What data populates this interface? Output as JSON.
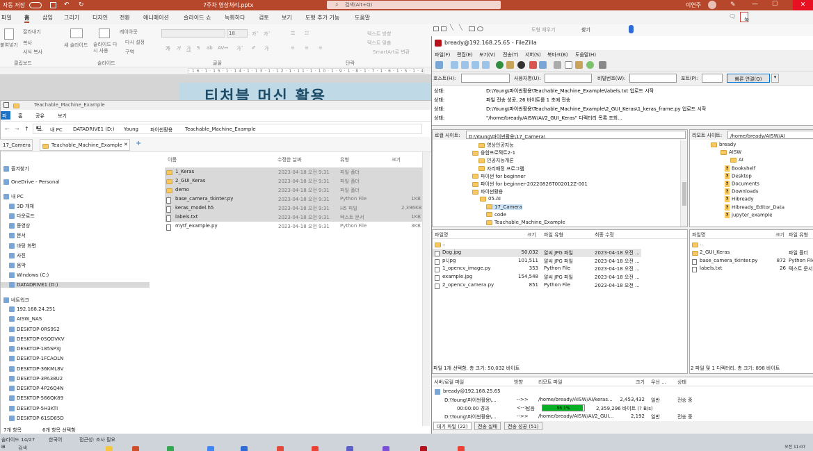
{
  "ppt": {
    "autosave": "자동 저장",
    "filename": "7주차 영상처리.pptx",
    "search": "검색(Alt+Q)",
    "user": "이연주",
    "record_button": "녹화하다",
    "tabs": [
      "파일",
      "홈",
      "삽입",
      "그리기",
      "디자인",
      "전환",
      "애니메이션",
      "슬라이드 쇼",
      "녹화하다",
      "검토",
      "보기",
      "도형 추가 기능",
      "도움말"
    ],
    "ribbon": {
      "paste": "붙여넣기",
      "cut": "잘라내기",
      "copy": "복사",
      "format_copy": "서식 복사",
      "clipboard": "클립보드",
      "new_slide": "새 슬라이드",
      "reuse_slide": "슬라이드 다시 사용",
      "layout": "레이아웃",
      "reset": "다시 설정",
      "section": "구역",
      "slides_group": "슬라이드",
      "font_size": "18",
      "font_group": "글꼴",
      "paragraph_group": "단락",
      "text_direction": "텍스트 방향",
      "text_align": "텍스트 맞춤",
      "smartart": "SmartArt로 변환",
      "shape_fill": "도형 채우기",
      "find": "찾기"
    },
    "slide_title": "티처블 머신 활용",
    "status_slide": "슬라이드 14/27",
    "status_lang": "한국어",
    "status_access": "접근성: 조사 필요"
  },
  "explorer": {
    "title": "Teachable_Machine_Example",
    "menu": [
      "파일",
      "홈",
      "공유",
      "보기"
    ],
    "address": [
      "내 PC",
      "DATADRIVE1 (D:)",
      "Young",
      "파이썬활용",
      "Teachable_Machine_Example"
    ],
    "tabs": [
      "17_Camera",
      "Teachable_Machine_Example"
    ],
    "nav": [
      {
        "label": "즐겨찾기",
        "icon": "star-icon"
      },
      {
        "label": "OneDrive - Personal",
        "icon": "cloud-icon"
      },
      {
        "label": "내 PC",
        "icon": "pc-icon"
      },
      {
        "label": "3D 개체",
        "icon": "cube-icon"
      },
      {
        "label": "다운로드",
        "icon": "download-icon"
      },
      {
        "label": "동영상",
        "icon": "video-icon"
      },
      {
        "label": "문서",
        "icon": "document-icon"
      },
      {
        "label": "바탕 화면",
        "icon": "desktop-icon"
      },
      {
        "label": "사진",
        "icon": "picture-icon"
      },
      {
        "label": "음악",
        "icon": "music-icon"
      },
      {
        "label": "Windows (C:)",
        "icon": "drive-icon"
      },
      {
        "label": "DATADRIVE1 (D:)",
        "icon": "drive-icon"
      },
      {
        "label": "네트워크",
        "icon": "network-icon"
      },
      {
        "label": "192.168.24.251",
        "icon": "computer-icon"
      },
      {
        "label": "AISW_NAS",
        "icon": "computer-icon"
      },
      {
        "label": "DESKTOP-0RS9S2",
        "icon": "computer-icon"
      },
      {
        "label": "DESKTOP-0SQDVKV",
        "icon": "computer-icon"
      },
      {
        "label": "DESKTOP-185SP3J",
        "icon": "computer-icon"
      },
      {
        "label": "DESKTOP-1FCAOLN",
        "icon": "computer-icon"
      },
      {
        "label": "DESKTOP-36KML8V",
        "icon": "computer-icon"
      },
      {
        "label": "DESKTOP-3PA38U2",
        "icon": "computer-icon"
      },
      {
        "label": "DESKTOP-4P26Q4N",
        "icon": "computer-icon"
      },
      {
        "label": "DESKTOP-566QK89",
        "icon": "computer-icon"
      },
      {
        "label": "DESKTOP-5H3KTI",
        "icon": "computer-icon"
      },
      {
        "label": "DESKTOP-61SD85D",
        "icon": "computer-icon"
      }
    ],
    "columns": [
      "이름",
      "수정한 날짜",
      "유형",
      "크기"
    ],
    "files": [
      {
        "name": "1_Keras",
        "date": "2023-04-18 오전 9:31",
        "type": "파일 폴더",
        "size": "",
        "folder": true,
        "sel": true
      },
      {
        "name": "2_GUI_Keras",
        "date": "2023-04-18 오전 9:31",
        "type": "파일 폴더",
        "size": "",
        "folder": true,
        "sel": true
      },
      {
        "name": "demo",
        "date": "2023-04-18 오전 9:31",
        "type": "파일 폴더",
        "size": "",
        "folder": true,
        "sel": true
      },
      {
        "name": "base_camera_tkinter.py",
        "date": "2023-04-18 오전 9:31",
        "type": "Python File",
        "size": "1KB",
        "folder": false,
        "sel": true
      },
      {
        "name": "keras_model.h5",
        "date": "2023-04-18 오전 9:31",
        "type": "H5 파일",
        "size": "2,396KB",
        "folder": false,
        "sel": true
      },
      {
        "name": "labels.txt",
        "date": "2023-04-18 오전 9:31",
        "type": "텍스트 문서",
        "size": "1KB",
        "folder": false,
        "sel": true
      },
      {
        "name": "mytf_example.py",
        "date": "2023-04-18 오전 9:31",
        "type": "Python File",
        "size": "3KB",
        "folder": false,
        "sel": false
      }
    ],
    "status_count": "7개 항목",
    "status_sel": "6개 항목 선택함"
  },
  "filezilla": {
    "title": "bready@192.168.25.65 - FileZilla",
    "menu": [
      "파일(F)",
      "편집(E)",
      "보기(V)",
      "전송(T)",
      "서버(S)",
      "북마크(B)",
      "도움말(H)"
    ],
    "host_label": "호스트(H):",
    "user_label": "사용자명(U):",
    "pass_label": "비밀번호(W):",
    "port_label": "포트(P):",
    "quickconnect": "빠른 연결(Q)",
    "log": [
      {
        "k": "상태:",
        "v": "D:\\Young\\파이썬활용\\Teachable_Machine_Example\\labels.txt 업로드 시작"
      },
      {
        "k": "상태:",
        "v": "파일 전송 성공, 26 바이트를 1 초에 전송"
      },
      {
        "k": "상태:",
        "v": "D:\\Young\\파이썬활용\\Teachable_Machine_Example\\2_GUI_Keras\\1_keras_frame.py 업로드 시작"
      },
      {
        "k": "상태:",
        "v": "\"/home/bready/AISW/AI/2_GUI_Keras\" 디렉터리 목록 조회..."
      }
    ],
    "local_label": "로컬 사이트:",
    "local_path": "D:\\Young\\파이썬활용\\17_Camera\\",
    "remote_label": "리모트 사이트:",
    "remote_path": "/home/bready/AISW/AI",
    "local_tree": [
      "영상인공지능",
      "융합프로젝트2-1",
      "인공지능개론",
      "자리배정 프로그램",
      "파이썬 for beginner",
      "파이썬 for beginner-20220826T002012Z-001",
      "파이썬활용",
      "05.AI",
      "17_Camera",
      "code",
      "Teachable_Machine_Example"
    ],
    "remote_tree": [
      {
        "label": "bready",
        "q": false
      },
      {
        "label": "AISW",
        "q": false
      },
      {
        "label": "AI",
        "q": false
      },
      {
        "label": "Bookshelf",
        "q": true
      },
      {
        "label": "Desktop",
        "q": true
      },
      {
        "label": "Documents",
        "q": true
      },
      {
        "label": "Downloads",
        "q": true
      },
      {
        "label": "Hibready",
        "q": true
      },
      {
        "label": "Hibready_Editor_Data",
        "q": true
      },
      {
        "label": "jupyter_example",
        "q": true
      }
    ],
    "local_cols": [
      "파일명",
      "크기",
      "파일 유형",
      "최종 수정"
    ],
    "local_files": [
      {
        "name": "..",
        "size": "",
        "type": "",
        "date": ""
      },
      {
        "name": "Dog.jpg",
        "size": "50,032",
        "type": "알씨 JPG 파일",
        "date": "2023-04-18 오전 ..."
      },
      {
        "name": "pi.jpg",
        "size": "101,511",
        "type": "알씨 JPG 파일",
        "date": "2023-04-18 오전 ..."
      },
      {
        "name": "1_opencv_image.py",
        "size": "353",
        "type": "Python File",
        "date": "2023-04-18 오전 ..."
      },
      {
        "name": "example.jpg",
        "size": "154,548",
        "type": "알씨 JPG 파일",
        "date": "2023-04-18 오전 ..."
      },
      {
        "name": "2_opencv_camera.py",
        "size": "851",
        "type": "Python File",
        "date": "2023-04-18 오전 ..."
      }
    ],
    "local_status": "파일 1개 선택함. 총 크기: 50,032 바이트",
    "remote_cols": [
      "파일명",
      "크기",
      "파일 유형"
    ],
    "remote_files": [
      {
        "name": "..",
        "size": "",
        "type": ""
      },
      {
        "name": "2_GUI_Keras",
        "size": "",
        "type": "파일 폴더"
      },
      {
        "name": "base_camera_tkinter.py",
        "size": "872",
        "type": "Python File"
      },
      {
        "name": "labels.txt",
        "size": "26",
        "type": "텍스트 문서"
      }
    ],
    "remote_status": "2 파일 및 1 디렉터리. 총 크기: 898 바이트",
    "queue_cols": [
      "서버/로컬 파일",
      "방향",
      "리모트 파일",
      "크기",
      "우선 ...",
      "상태"
    ],
    "queue_server": "bready@192.168.25.65",
    "queue_rows": [
      {
        "local": "D:\\Young\\파이썬활용\\...",
        "dir": "-->>",
        "remote": "/home/bready/AISW/AI/keras...",
        "size": "2,453,432",
        "prio": "일반",
        "state": "전송 중"
      },
      {
        "local": "00:00:00 경과",
        "dir": "<-->",
        "remote": "2,359,296 바이트 (? B/s)",
        "size": "",
        "prio": "",
        "state": ""
      },
      {
        "local": "D:\\Young\\파이썬활용\\...",
        "dir": "-->>",
        "remote": "/home/bready/AISW/AI/2_GUI...",
        "size": "2,192",
        "prio": "일반",
        "state": "전송 중"
      }
    ],
    "eta_label": "남음",
    "progress_text": "96.1%",
    "progress_fraction": 0.961,
    "queue_tabs": [
      "대기 파일 (22)",
      "전송 실패",
      "전송 성공 (51)"
    ]
  },
  "taskbar": {
    "search": "검색",
    "time": "오전 11:07"
  }
}
